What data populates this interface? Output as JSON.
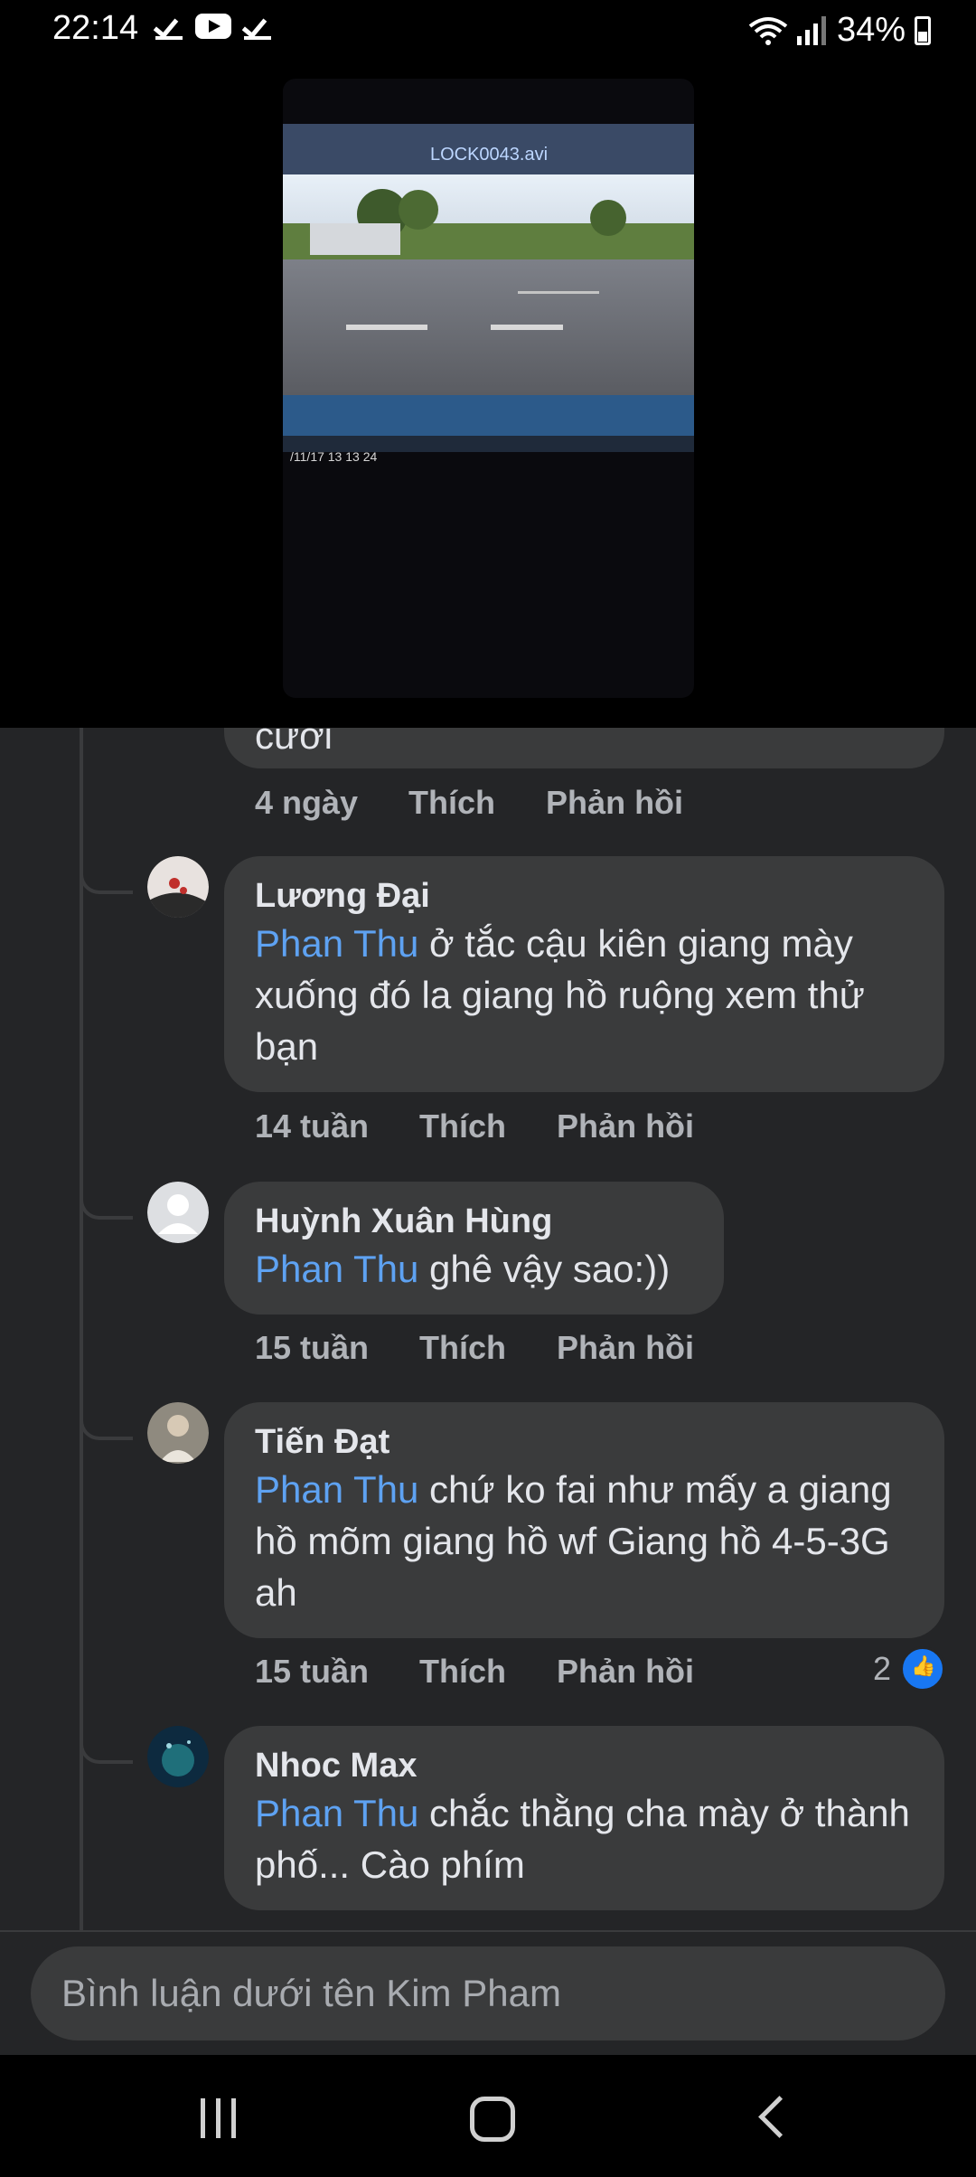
{
  "status_bar": {
    "time": "22:14",
    "battery": "34%"
  },
  "video": {
    "filename": "LOCK0043.avi",
    "timestamp": "/11/17 13 13 24"
  },
  "comments": {
    "partial": {
      "text": "cười",
      "time": "4 ngày",
      "like": "Thích",
      "reply": "Phản hồi"
    },
    "items": [
      {
        "author": "Lương Đại",
        "mention": "Phan Thu",
        "text": " ở tắc cậu kiên giang mày xuống đó la giang hồ ruộng xem thử bạn",
        "time": "14 tuần",
        "like": "Thích",
        "reply": "Phản hồi"
      },
      {
        "author": "Huỳnh Xuân Hùng",
        "mention": "Phan Thu",
        "text": " ghê vậy sao:))",
        "time": "15 tuần",
        "like": "Thích",
        "reply": "Phản hồi"
      },
      {
        "author": "Tiến Đạt",
        "mention": "Phan Thu",
        "text": " chứ ko fai như mấy a giang hồ mõm giang hồ wf Giang hồ 4-5-3G ah",
        "time": "15 tuần",
        "like": "Thích",
        "reply": "Phản hồi",
        "reaction_count": "2"
      },
      {
        "author": "Nhoc Max",
        "mention": "Phan Thu",
        "text": " chắc thằng cha mày ở thành phố... Cào phím"
      }
    ]
  },
  "composer": {
    "placeholder": "Bình luận dưới tên Kim Pham"
  }
}
